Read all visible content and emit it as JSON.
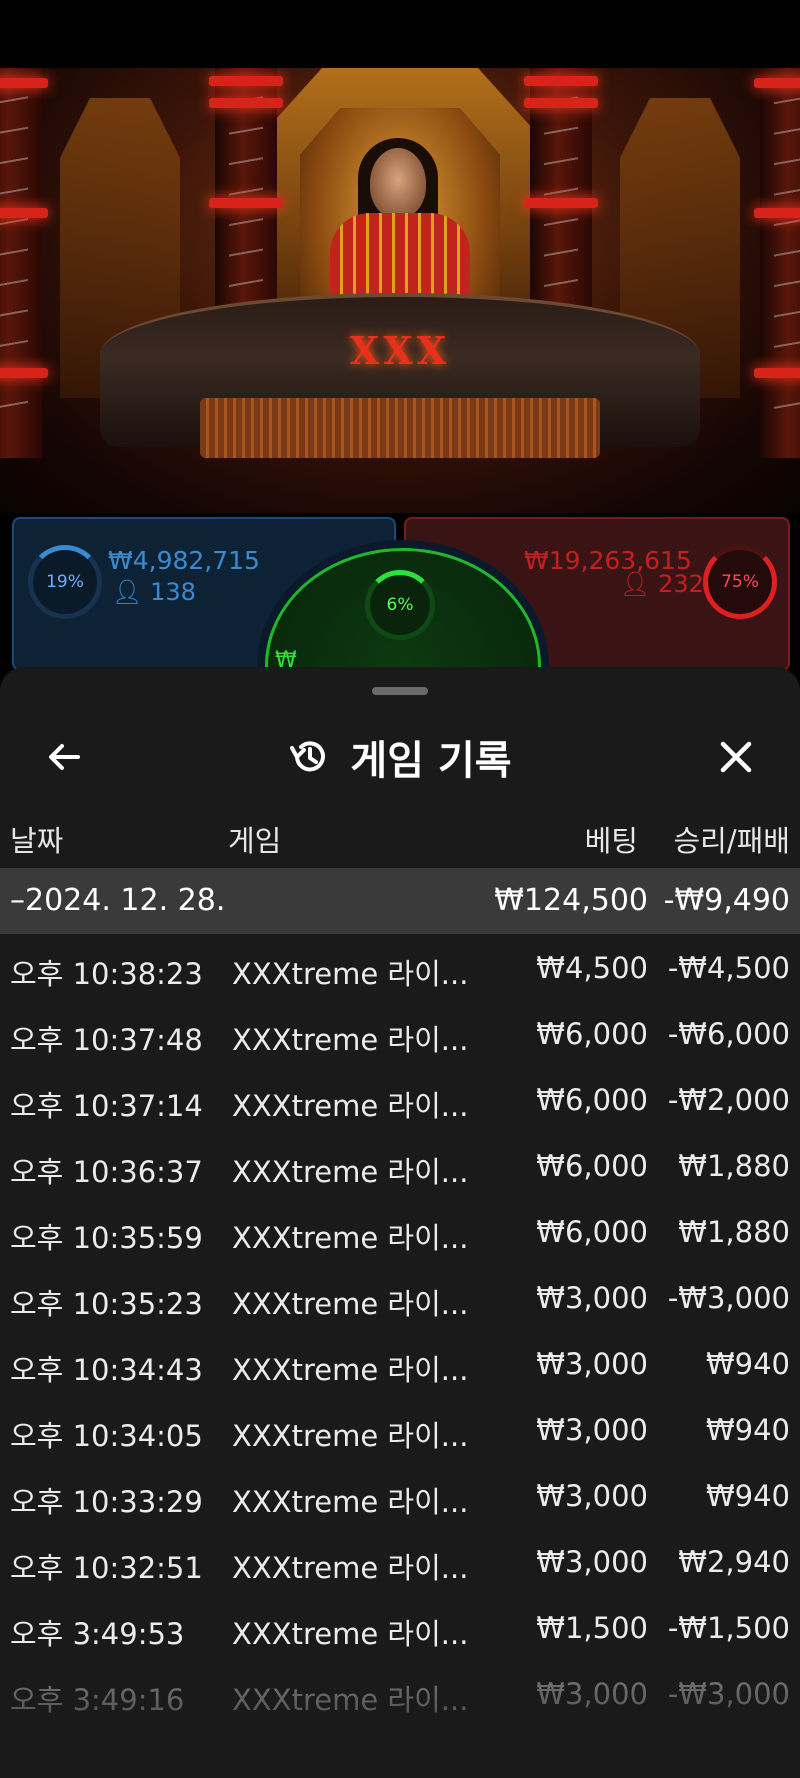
{
  "video": {
    "table_logo": "XXX"
  },
  "bets": {
    "player": {
      "percent": "19%",
      "amount": "₩4,982,715",
      "players": "138"
    },
    "tie": {
      "percent": "6%",
      "amount": "₩"
    },
    "banker": {
      "percent": "75%",
      "amount": "₩19,263,615",
      "players": "232"
    }
  },
  "sheet": {
    "title": "게임 기록",
    "back_icon": "arrow-left-icon",
    "history_icon": "history-icon",
    "close_icon": "close-icon"
  },
  "columns": {
    "date": "날짜",
    "game": "게임",
    "bet": "베팅",
    "win_loss": "승리/패배"
  },
  "group": {
    "label": "–2024. 12. 28.",
    "bet": "₩124,500",
    "win_loss": "-₩9,490"
  },
  "rows": [
    {
      "time": "오후 10:38:23",
      "game": "XXXtreme 라이...",
      "bet": "₩4,500",
      "win_loss": "-₩4,500"
    },
    {
      "time": "오후 10:37:48",
      "game": "XXXtreme 라이...",
      "bet": "₩6,000",
      "win_loss": "-₩6,000"
    },
    {
      "time": "오후 10:37:14",
      "game": "XXXtreme 라이...",
      "bet": "₩6,000",
      "win_loss": "-₩2,000"
    },
    {
      "time": "오후 10:36:37",
      "game": "XXXtreme 라이...",
      "bet": "₩6,000",
      "win_loss": "₩1,880"
    },
    {
      "time": "오후 10:35:59",
      "game": "XXXtreme 라이...",
      "bet": "₩6,000",
      "win_loss": "₩1,880"
    },
    {
      "time": "오후 10:35:23",
      "game": "XXXtreme 라이...",
      "bet": "₩3,000",
      "win_loss": "-₩3,000"
    },
    {
      "time": "오후 10:34:43",
      "game": "XXXtreme 라이...",
      "bet": "₩3,000",
      "win_loss": "₩940"
    },
    {
      "time": "오후 10:34:05",
      "game": "XXXtreme 라이...",
      "bet": "₩3,000",
      "win_loss": "₩940"
    },
    {
      "time": "오후 10:33:29",
      "game": "XXXtreme 라이...",
      "bet": "₩3,000",
      "win_loss": "₩940"
    },
    {
      "time": "오후 10:32:51",
      "game": "XXXtreme 라이...",
      "bet": "₩3,000",
      "win_loss": "₩2,940"
    },
    {
      "time": "오후 3:49:53",
      "game": "XXXtreme 라이...",
      "bet": "₩1,500",
      "win_loss": "-₩1,500"
    },
    {
      "time": "오후 3:49:16",
      "game": "XXXtreme 라이...",
      "bet": "₩3,000",
      "win_loss": "-₩3,000"
    }
  ],
  "colors": {
    "player": "#3a8ad0",
    "banker": "#c22020",
    "tie": "#2ee03a",
    "sheet_bg": "#1a1a1a",
    "group_bg": "#3a3a3a"
  }
}
